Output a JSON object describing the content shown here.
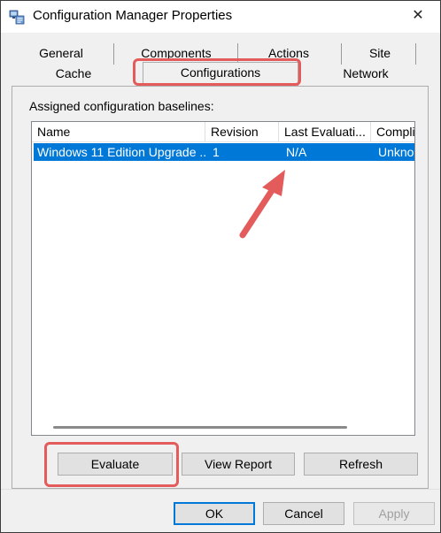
{
  "window": {
    "title": "Configuration Manager Properties",
    "close_glyph": "✕"
  },
  "tabs": {
    "back_row": [
      "General",
      "Components",
      "Actions",
      "Site"
    ],
    "front_row": [
      "Cache",
      "Configurations",
      "Network"
    ],
    "active": "Configurations"
  },
  "panel": {
    "section_label": "Assigned configuration baselines:"
  },
  "list": {
    "columns": [
      "Name",
      "Revision",
      "Last Evaluati...",
      "Compli"
    ],
    "rows": [
      {
        "name": "Windows 11 Edition Upgrade ...",
        "revision": "1",
        "last_evaluation": "N/A",
        "compliance": "Unkno"
      }
    ],
    "selected_row": 0
  },
  "actions": {
    "evaluate": "Evaluate",
    "view_report": "View Report",
    "refresh": "Refresh"
  },
  "footer": {
    "ok": "OK",
    "cancel": "Cancel",
    "apply": "Apply"
  },
  "colors": {
    "selection": "#0078d7",
    "annotation": "#e35b5b"
  },
  "icons": [
    "config-manager-app-icon",
    "close-icon",
    "arrow-annotation-icon"
  ]
}
